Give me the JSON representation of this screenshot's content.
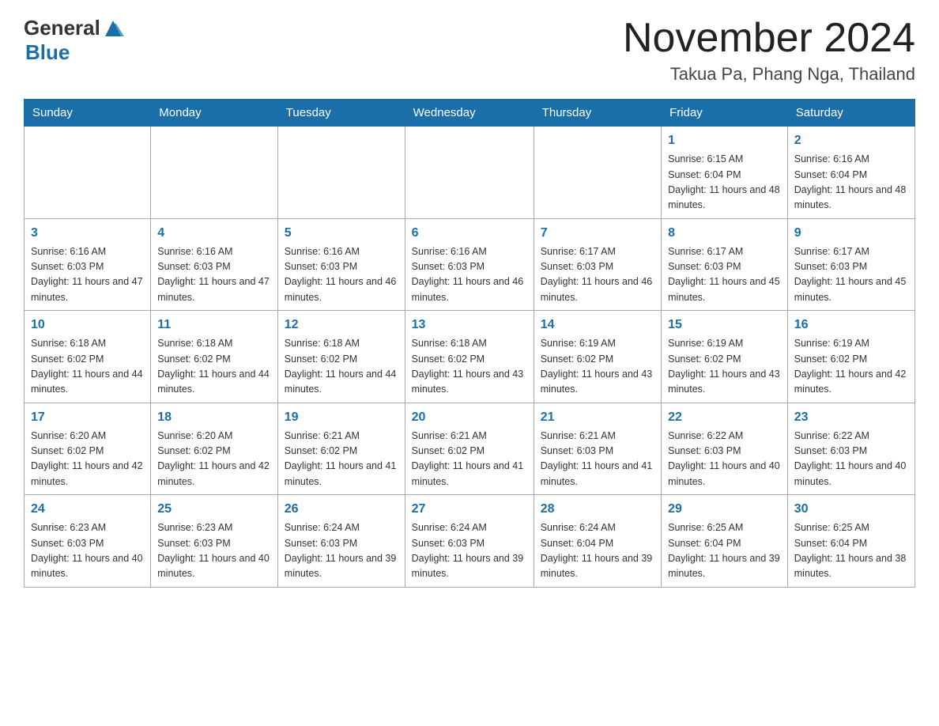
{
  "header": {
    "logo_general": "General",
    "logo_blue": "Blue",
    "month_title": "November 2024",
    "subtitle": "Takua Pa, Phang Nga, Thailand"
  },
  "days_of_week": [
    "Sunday",
    "Monday",
    "Tuesday",
    "Wednesday",
    "Thursday",
    "Friday",
    "Saturday"
  ],
  "weeks": [
    [
      {
        "day": "",
        "info": ""
      },
      {
        "day": "",
        "info": ""
      },
      {
        "day": "",
        "info": ""
      },
      {
        "day": "",
        "info": ""
      },
      {
        "day": "",
        "info": ""
      },
      {
        "day": "1",
        "info": "Sunrise: 6:15 AM\nSunset: 6:04 PM\nDaylight: 11 hours and 48 minutes."
      },
      {
        "day": "2",
        "info": "Sunrise: 6:16 AM\nSunset: 6:04 PM\nDaylight: 11 hours and 48 minutes."
      }
    ],
    [
      {
        "day": "3",
        "info": "Sunrise: 6:16 AM\nSunset: 6:03 PM\nDaylight: 11 hours and 47 minutes."
      },
      {
        "day": "4",
        "info": "Sunrise: 6:16 AM\nSunset: 6:03 PM\nDaylight: 11 hours and 47 minutes."
      },
      {
        "day": "5",
        "info": "Sunrise: 6:16 AM\nSunset: 6:03 PM\nDaylight: 11 hours and 46 minutes."
      },
      {
        "day": "6",
        "info": "Sunrise: 6:16 AM\nSunset: 6:03 PM\nDaylight: 11 hours and 46 minutes."
      },
      {
        "day": "7",
        "info": "Sunrise: 6:17 AM\nSunset: 6:03 PM\nDaylight: 11 hours and 46 minutes."
      },
      {
        "day": "8",
        "info": "Sunrise: 6:17 AM\nSunset: 6:03 PM\nDaylight: 11 hours and 45 minutes."
      },
      {
        "day": "9",
        "info": "Sunrise: 6:17 AM\nSunset: 6:03 PM\nDaylight: 11 hours and 45 minutes."
      }
    ],
    [
      {
        "day": "10",
        "info": "Sunrise: 6:18 AM\nSunset: 6:02 PM\nDaylight: 11 hours and 44 minutes."
      },
      {
        "day": "11",
        "info": "Sunrise: 6:18 AM\nSunset: 6:02 PM\nDaylight: 11 hours and 44 minutes."
      },
      {
        "day": "12",
        "info": "Sunrise: 6:18 AM\nSunset: 6:02 PM\nDaylight: 11 hours and 44 minutes."
      },
      {
        "day": "13",
        "info": "Sunrise: 6:18 AM\nSunset: 6:02 PM\nDaylight: 11 hours and 43 minutes."
      },
      {
        "day": "14",
        "info": "Sunrise: 6:19 AM\nSunset: 6:02 PM\nDaylight: 11 hours and 43 minutes."
      },
      {
        "day": "15",
        "info": "Sunrise: 6:19 AM\nSunset: 6:02 PM\nDaylight: 11 hours and 43 minutes."
      },
      {
        "day": "16",
        "info": "Sunrise: 6:19 AM\nSunset: 6:02 PM\nDaylight: 11 hours and 42 minutes."
      }
    ],
    [
      {
        "day": "17",
        "info": "Sunrise: 6:20 AM\nSunset: 6:02 PM\nDaylight: 11 hours and 42 minutes."
      },
      {
        "day": "18",
        "info": "Sunrise: 6:20 AM\nSunset: 6:02 PM\nDaylight: 11 hours and 42 minutes."
      },
      {
        "day": "19",
        "info": "Sunrise: 6:21 AM\nSunset: 6:02 PM\nDaylight: 11 hours and 41 minutes."
      },
      {
        "day": "20",
        "info": "Sunrise: 6:21 AM\nSunset: 6:02 PM\nDaylight: 11 hours and 41 minutes."
      },
      {
        "day": "21",
        "info": "Sunrise: 6:21 AM\nSunset: 6:03 PM\nDaylight: 11 hours and 41 minutes."
      },
      {
        "day": "22",
        "info": "Sunrise: 6:22 AM\nSunset: 6:03 PM\nDaylight: 11 hours and 40 minutes."
      },
      {
        "day": "23",
        "info": "Sunrise: 6:22 AM\nSunset: 6:03 PM\nDaylight: 11 hours and 40 minutes."
      }
    ],
    [
      {
        "day": "24",
        "info": "Sunrise: 6:23 AM\nSunset: 6:03 PM\nDaylight: 11 hours and 40 minutes."
      },
      {
        "day": "25",
        "info": "Sunrise: 6:23 AM\nSunset: 6:03 PM\nDaylight: 11 hours and 40 minutes."
      },
      {
        "day": "26",
        "info": "Sunrise: 6:24 AM\nSunset: 6:03 PM\nDaylight: 11 hours and 39 minutes."
      },
      {
        "day": "27",
        "info": "Sunrise: 6:24 AM\nSunset: 6:03 PM\nDaylight: 11 hours and 39 minutes."
      },
      {
        "day": "28",
        "info": "Sunrise: 6:24 AM\nSunset: 6:04 PM\nDaylight: 11 hours and 39 minutes."
      },
      {
        "day": "29",
        "info": "Sunrise: 6:25 AM\nSunset: 6:04 PM\nDaylight: 11 hours and 39 minutes."
      },
      {
        "day": "30",
        "info": "Sunrise: 6:25 AM\nSunset: 6:04 PM\nDaylight: 11 hours and 38 minutes."
      }
    ]
  ]
}
